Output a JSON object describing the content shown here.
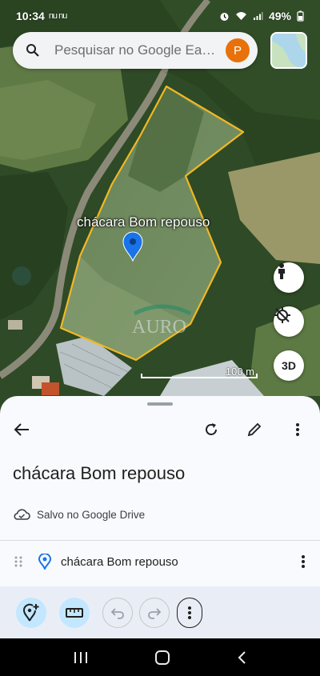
{
  "status_bar": {
    "time": "10:34",
    "notifications": "nu nu",
    "battery": "49%",
    "icons": [
      "alarm-icon",
      "wifi-icon",
      "signal-icon",
      "battery-icon"
    ]
  },
  "search": {
    "placeholder": "Pesquisar no Google Ea…",
    "avatar_letter": "P",
    "avatar_color": "#e8710a"
  },
  "map": {
    "place_label": "chácara Bom repouso",
    "watermark": "AURO",
    "polygon_color": "#f2b824",
    "pin_color": "#1a73e8",
    "scale_label": "100 m",
    "controls": {
      "three_d_label": "3D"
    }
  },
  "sheet": {
    "title": "chácara Bom repouso",
    "saved_status": "Salvo no Google Drive",
    "feature": {
      "name": "chácara Bom repouso"
    },
    "accent": "#c2e7ff"
  },
  "icons": {
    "back": "arrow-back-icon",
    "refresh": "refresh-icon",
    "edit": "pencil-icon",
    "more": "more-vert-icon",
    "add_place": "add-location-icon",
    "measure": "ruler-icon",
    "undo": "undo-icon",
    "redo": "redo-icon"
  }
}
